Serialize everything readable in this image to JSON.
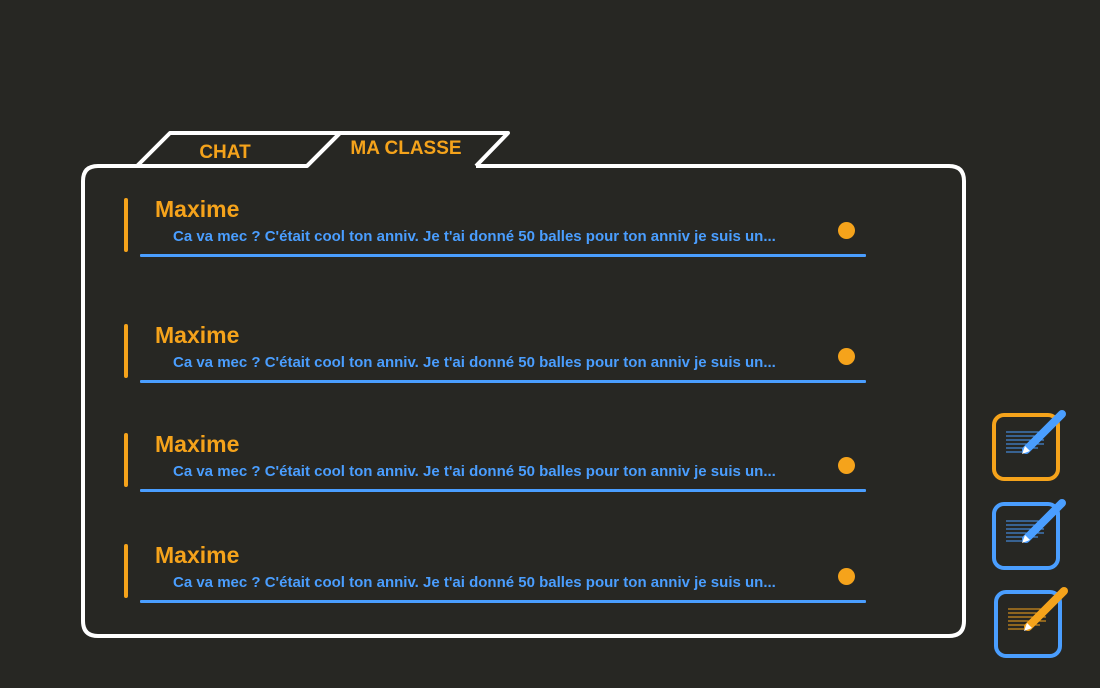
{
  "tabs": {
    "chat_label": "CHAT",
    "classe_label": "MA CLASSE"
  },
  "messages": [
    {
      "sender": "Maxime",
      "preview": "Ca va mec ? C'était cool ton anniv. Je t'ai donné 50 balles pour ton anniv je suis un..."
    },
    {
      "sender": "Maxime",
      "preview": "Ca va mec ? C'était cool ton anniv. Je t'ai donné 50 balles pour ton anniv je suis un..."
    },
    {
      "sender": "Maxime",
      "preview": "Ca va mec ? C'était cool ton anniv. Je t'ai donné 50 balles pour ton anniv je suis un..."
    },
    {
      "sender": "Maxime",
      "preview": "Ca va mec ? C'était cool ton anniv. Je t'ai donné 50 balles pour ton anniv je suis un..."
    }
  ],
  "side_buttons": [
    {
      "icon": "compose-icon",
      "frame_color": "#f5a31b",
      "pencil_color": "#4a9eff"
    },
    {
      "icon": "compose-icon",
      "frame_color": "#4a9eff",
      "pencil_color": "#4a9eff"
    },
    {
      "icon": "compose-icon",
      "frame_color": "#4a9eff",
      "pencil_color": "#f5a31b"
    }
  ],
  "colors": {
    "background": "#272723",
    "accent_orange": "#f5a31b",
    "accent_blue": "#4a9eff",
    "outline": "#ffffff"
  }
}
